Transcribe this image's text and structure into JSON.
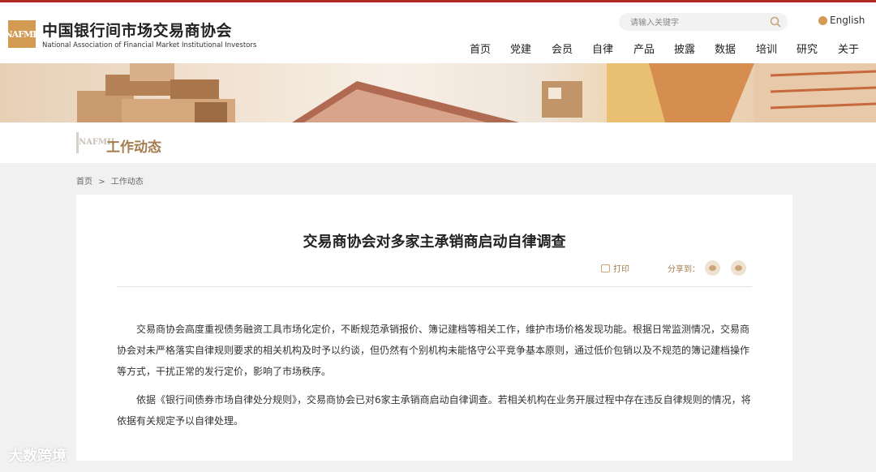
{
  "header": {
    "logo_mark": "NAFMII",
    "org_name_cn": "中国银行间市场交易商协会",
    "org_name_en": "National Association of Financial Market Institutional Investors",
    "search_placeholder": "请输入关键字",
    "language_label": "English",
    "nav": [
      "首页",
      "党建",
      "会员",
      "自律",
      "产品",
      "披露",
      "数据",
      "培训",
      "研究",
      "关于"
    ]
  },
  "section": {
    "mark": "NAFMII",
    "title": "工作动态"
  },
  "breadcrumb": [
    "首页",
    ">",
    "工作动态"
  ],
  "article": {
    "title": "交易商协会对多家主承销商启动自律调查",
    "print_label": "打印",
    "share_label": "分享到：",
    "paragraphs": [
      "交易商协会高度重视债务融资工具市场化定价，不断规范承销报价、簿记建档等相关工作，维护市场价格发现功能。根据日常监测情况，交易商协会对未严格落实自律规则要求的相关机构及时予以约谈，但仍然有个别机构未能恪守公平竞争基本原则，通过低价包销以及不规范的簿记建档操作等方式，干扰正常的发行定价，影响了市场秩序。",
      "依据《银行间债券市场自律处分规则》，交易商协会已对6家主承销商启动自律调查。若相关机构在业务开展过程中存在违反自律规则的情况，将依据有关规定予以自律处理。"
    ]
  },
  "watermark": "大数跨境",
  "colors": {
    "brand_red": "#b22a25",
    "gold": "#a57d4f",
    "logo_gold": "#d39a54"
  }
}
